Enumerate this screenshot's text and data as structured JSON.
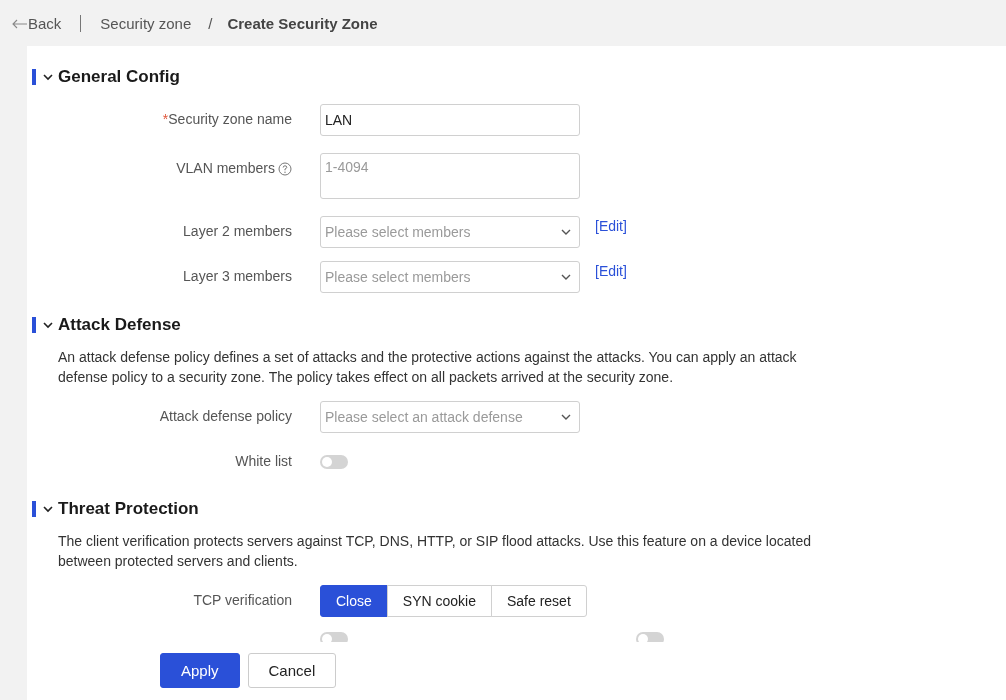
{
  "breadcrumb": {
    "back": "Back",
    "parent": "Security zone",
    "separator": "/",
    "current": "Create Security Zone"
  },
  "sections": [
    {
      "title": "General Config",
      "expanded": true,
      "rows": [
        {
          "kind": "input",
          "label": "Security zone name",
          "required_mark": "*",
          "value": "LAN"
        },
        {
          "kind": "textarea",
          "label": "VLAN members",
          "help": true,
          "placeholder": "1-4094"
        },
        {
          "kind": "select",
          "label": "Layer 2 members",
          "placeholder": "Please select members",
          "link": "[Edit]"
        },
        {
          "kind": "select",
          "label": "Layer 3 members",
          "placeholder": "Please select members",
          "link": "[Edit]"
        }
      ]
    },
    {
      "title": "Attack Defense",
      "expanded": true,
      "description": "An attack defense policy defines a set of attacks and the protective actions against the attacks. You can apply an attack defense policy to a security zone. The policy takes effect on all packets arrived at the security zone.",
      "rows": [
        {
          "kind": "select",
          "label": "Attack defense policy",
          "placeholder": "Please select an attack defense"
        },
        {
          "kind": "toggle",
          "label": "White list",
          "on": false
        }
      ]
    },
    {
      "title": "Threat Protection",
      "expanded": true,
      "description": "The client verification protects servers against TCP, DNS, HTTP, or SIP flood attacks. Use this feature on a device located between protected servers and clients.",
      "rows": [
        {
          "kind": "segmented",
          "label": "TCP verification",
          "options": [
            {
              "label": "Close",
              "selected": true
            },
            {
              "label": "SYN cookie",
              "selected": false
            },
            {
              "label": "Safe reset",
              "selected": false
            }
          ]
        },
        {
          "kind": "partial",
          "toggles": [
            {
              "on": false
            },
            {
              "on": false
            }
          ]
        }
      ]
    }
  ],
  "buttons": [
    {
      "label": "Apply",
      "kind": "primary"
    },
    {
      "label": "Cancel",
      "kind": "default"
    }
  ]
}
